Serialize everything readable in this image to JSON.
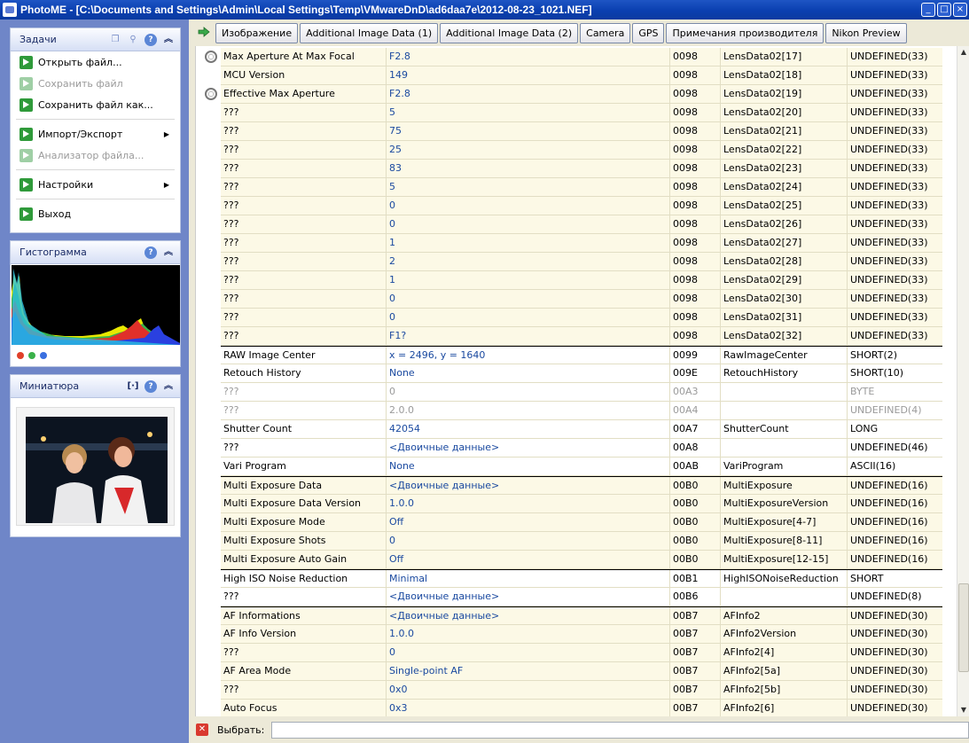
{
  "window": {
    "title": "PhotoME - [C:\\Documents and Settings\\Admin\\Local Settings\\Temp\\VMwareDnD\\ad6daa7e\\2012-08-23_1021.NEF]",
    "buttons": [
      "_",
      "□",
      "×"
    ]
  },
  "sidebar": {
    "tasks": {
      "title": "Задачи",
      "items": [
        {
          "label": "Открыть файл...",
          "enabled": true
        },
        {
          "label": "Сохранить файл",
          "enabled": false
        },
        {
          "label": "Сохранить файл как...",
          "enabled": true
        },
        {
          "label": "Импорт/Экспорт",
          "enabled": true,
          "submenu": true
        },
        {
          "label": "Анализатор файла...",
          "enabled": false
        },
        {
          "label": "Настройки",
          "enabled": true,
          "submenu": true
        },
        {
          "label": "Выход",
          "enabled": true
        }
      ]
    },
    "histogram": {
      "title": "Гистограмма",
      "channels": [
        "#e0402a",
        "#3ab14a",
        "#3a6fe0"
      ]
    },
    "thumbnail": {
      "title": "Миниатюра"
    }
  },
  "tabs": [
    "Изображение",
    "Additional Image Data (1)",
    "Additional Image Data (2)",
    "Camera",
    "GPS",
    "Примечания производителя",
    "Nikon Preview"
  ],
  "rows": [
    {
      "name": "Max Aperture At Max Focal",
      "value": "F2.8",
      "tag": "0098",
      "key": "LensData02[17]",
      "type": "UNDEFINED(33)",
      "icon": true,
      "shade": true
    },
    {
      "name": "MCU Version",
      "value": "149",
      "tag": "0098",
      "key": "LensData02[18]",
      "type": "UNDEFINED(33)",
      "shade": true
    },
    {
      "name": "Effective Max Aperture",
      "value": "F2.8",
      "tag": "0098",
      "key": "LensData02[19]",
      "type": "UNDEFINED(33)",
      "icon": true,
      "shade": true
    },
    {
      "name": "???",
      "value": "5",
      "tag": "0098",
      "key": "LensData02[20]",
      "type": "UNDEFINED(33)",
      "shade": true
    },
    {
      "name": "???",
      "value": "75",
      "tag": "0098",
      "key": "LensData02[21]",
      "type": "UNDEFINED(33)",
      "shade": true
    },
    {
      "name": "???",
      "value": "25",
      "tag": "0098",
      "key": "LensData02[22]",
      "type": "UNDEFINED(33)",
      "shade": true
    },
    {
      "name": "???",
      "value": "83",
      "tag": "0098",
      "key": "LensData02[23]",
      "type": "UNDEFINED(33)",
      "shade": true
    },
    {
      "name": "???",
      "value": "5",
      "tag": "0098",
      "key": "LensData02[24]",
      "type": "UNDEFINED(33)",
      "shade": true
    },
    {
      "name": "???",
      "value": "0",
      "tag": "0098",
      "key": "LensData02[25]",
      "type": "UNDEFINED(33)",
      "shade": true
    },
    {
      "name": "???",
      "value": "0",
      "tag": "0098",
      "key": "LensData02[26]",
      "type": "UNDEFINED(33)",
      "shade": true
    },
    {
      "name": "???",
      "value": "1",
      "tag": "0098",
      "key": "LensData02[27]",
      "type": "UNDEFINED(33)",
      "shade": true
    },
    {
      "name": "???",
      "value": "2",
      "tag": "0098",
      "key": "LensData02[28]",
      "type": "UNDEFINED(33)",
      "shade": true
    },
    {
      "name": "???",
      "value": "1",
      "tag": "0098",
      "key": "LensData02[29]",
      "type": "UNDEFINED(33)",
      "shade": true
    },
    {
      "name": "???",
      "value": "0",
      "tag": "0098",
      "key": "LensData02[30]",
      "type": "UNDEFINED(33)",
      "shade": true
    },
    {
      "name": "???",
      "value": "0",
      "tag": "0098",
      "key": "LensData02[31]",
      "type": "UNDEFINED(33)",
      "shade": true
    },
    {
      "name": "???",
      "value": "F1?",
      "tag": "0098",
      "key": "LensData02[32]",
      "type": "UNDEFINED(33)",
      "shade": true
    },
    {
      "name": "RAW Image Center",
      "value": "x = 2496, y = 1640",
      "tag": "0099",
      "key": "RawImageCenter",
      "type": "SHORT(2)",
      "groupsep": true
    },
    {
      "name": "Retouch History",
      "value": "None",
      "tag": "009E",
      "key": "RetouchHistory",
      "type": "SHORT(10)"
    },
    {
      "name": "???",
      "value": "0",
      "tag": "00A3",
      "key": "",
      "type": "BYTE",
      "muted": true
    },
    {
      "name": "???",
      "value": "2.0.0",
      "tag": "00A4",
      "key": "",
      "type": "UNDEFINED(4)",
      "muted": true
    },
    {
      "name": "Shutter Count",
      "value": "42054",
      "tag": "00A7",
      "key": "ShutterCount",
      "type": "LONG"
    },
    {
      "name": "???",
      "value": "<Двоичные данные>",
      "tag": "00A8",
      "key": "",
      "type": "UNDEFINED(46)"
    },
    {
      "name": "Vari Program",
      "value": "None",
      "tag": "00AB",
      "key": "VariProgram",
      "type": "ASCII(16)"
    },
    {
      "name": "Multi Exposure Data",
      "value": "<Двоичные данные>",
      "tag": "00B0",
      "key": "MultiExposure",
      "type": "UNDEFINED(16)",
      "groupsep": true,
      "shade": true
    },
    {
      "name": "Multi Exposure Data Version",
      "value": "1.0.0",
      "tag": "00B0",
      "key": "MultiExposureVersion",
      "type": "UNDEFINED(16)",
      "shade": true
    },
    {
      "name": "Multi Exposure Mode",
      "value": "Off",
      "tag": "00B0",
      "key": "MultiExposure[4-7]",
      "type": "UNDEFINED(16)",
      "shade": true
    },
    {
      "name": "Multi Exposure Shots",
      "value": "0",
      "tag": "00B0",
      "key": "MultiExposure[8-11]",
      "type": "UNDEFINED(16)",
      "shade": true
    },
    {
      "name": "Multi Exposure Auto Gain",
      "value": "Off",
      "tag": "00B0",
      "key": "MultiExposure[12-15]",
      "type": "UNDEFINED(16)",
      "shade": true
    },
    {
      "name": "High ISO Noise Reduction",
      "value": "Minimal",
      "tag": "00B1",
      "key": "HighISONoiseReduction",
      "type": "SHORT",
      "groupsep": true
    },
    {
      "name": "???",
      "value": "<Двоичные данные>",
      "tag": "00B6",
      "key": "",
      "type": "UNDEFINED(8)"
    },
    {
      "name": "AF Informations",
      "value": "<Двоичные данные>",
      "tag": "00B7",
      "key": "AFInfo2",
      "type": "UNDEFINED(30)",
      "groupsep": true,
      "shade": true
    },
    {
      "name": "AF Info Version",
      "value": "1.0.0",
      "tag": "00B7",
      "key": "AFInfo2Version",
      "type": "UNDEFINED(30)",
      "shade": true
    },
    {
      "name": "???",
      "value": "0",
      "tag": "00B7",
      "key": "AFInfo2[4]",
      "type": "UNDEFINED(30)",
      "shade": true
    },
    {
      "name": "AF Area Mode",
      "value": "Single-point AF",
      "tag": "00B7",
      "key": "AFInfo2[5a]",
      "type": "UNDEFINED(30)",
      "shade": true
    },
    {
      "name": "???",
      "value": "0x0",
      "tag": "00B7",
      "key": "AFInfo2[5b]",
      "type": "UNDEFINED(30)",
      "shade": true
    },
    {
      "name": "Auto Focus",
      "value": "0x3",
      "tag": "00B7",
      "key": "AFInfo2[6]",
      "type": "UNDEFINED(30)",
      "shade": true
    }
  ],
  "bottom": {
    "label": "Выбрать:",
    "value": ""
  }
}
